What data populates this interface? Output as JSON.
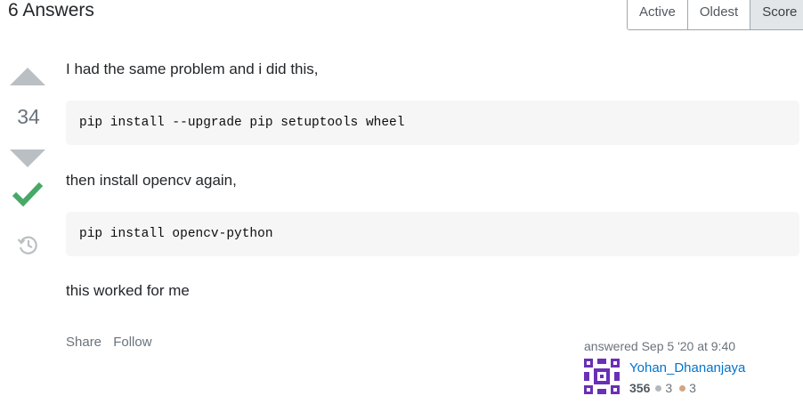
{
  "header": {
    "title": "6 Answers",
    "sort_tabs": [
      "Active",
      "Oldest",
      "Score"
    ]
  },
  "answer": {
    "vote_count": "34",
    "paragraph_1": "I had the same problem and i did this,",
    "code_1": "pip install --upgrade pip setuptools wheel",
    "paragraph_2": "then install opencv again,",
    "code_2": "pip install opencv-python",
    "paragraph_3": "this worked for me",
    "menu": {
      "share": "Share",
      "follow": "Follow"
    },
    "signature": {
      "action": "answered Sep 5 '20 at 9:40",
      "user": "Yohan_Dhananjaya",
      "reputation": "356",
      "silver_badges": "3",
      "bronze_badges": "3"
    }
  },
  "colors": {
    "accent_link": "#0074cc",
    "accepted_green": "#2f6f44",
    "vote_arrow": "#babfc4"
  }
}
